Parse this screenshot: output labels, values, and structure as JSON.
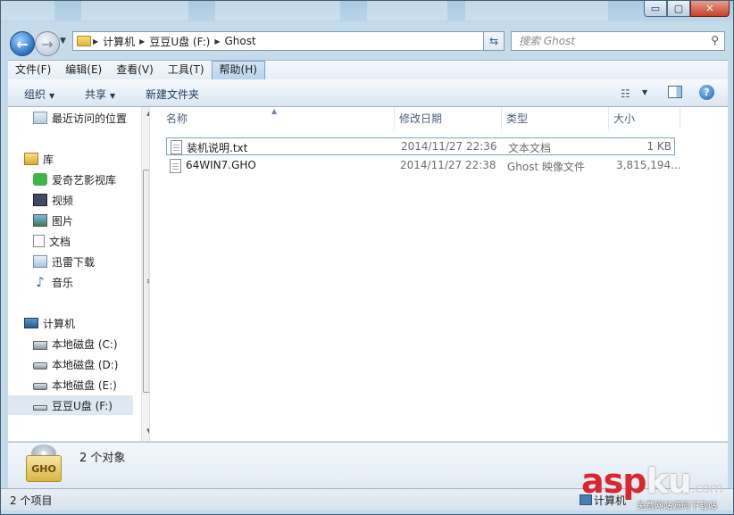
{
  "window": {
    "caption_buttons": {
      "minimize": "▭",
      "maximize": "▢",
      "close": "✕"
    }
  },
  "nav": {
    "breadcrumb": [
      "计算机",
      "豆豆U盘 (F:)",
      "Ghost"
    ],
    "search_placeholder": "搜索 Ghost"
  },
  "menu": [
    "文件(F)",
    "编辑(E)",
    "查看(V)",
    "工具(T)",
    "帮助(H)"
  ],
  "menu_active_index": 4,
  "commandbar": {
    "organize": "组织",
    "share": "共享",
    "new_folder": "新建文件夹",
    "help_glyph": "?"
  },
  "sidebar": {
    "recent": "最近访问的位置",
    "library": "库",
    "library_items": [
      "爱奇艺影视库",
      "视频",
      "图片",
      "文档",
      "迅雷下载",
      "音乐"
    ],
    "computer": "计算机",
    "drives": [
      "本地磁盘 (C:)",
      "本地磁盘 (D:)",
      "本地磁盘 (E:)",
      "豆豆U盘 (F:)"
    ]
  },
  "columns": {
    "name": "名称",
    "date": "修改日期",
    "type": "类型",
    "size": "大小"
  },
  "files": [
    {
      "name": "装机说明.txt",
      "date": "2014/11/27 22:36",
      "type": "文本文档",
      "size": "1 KB"
    },
    {
      "name": "64WIN7.GHO",
      "date": "2014/11/27 22:38",
      "type": "Ghost 映像文件",
      "size": "3,815,194..."
    }
  ],
  "details": {
    "icon_label": "GHO",
    "count": "2 个对象"
  },
  "status": {
    "items": "2 个项目",
    "location": "计算机"
  },
  "watermark": {
    "asp": "asp",
    "ku": "ku",
    "com": ".com",
    "sub": "免费网站源码下载站"
  },
  "colors": {
    "accent": "#1e395b",
    "selection_border": "#7da2ce",
    "watermark_red": "#d8272f"
  }
}
